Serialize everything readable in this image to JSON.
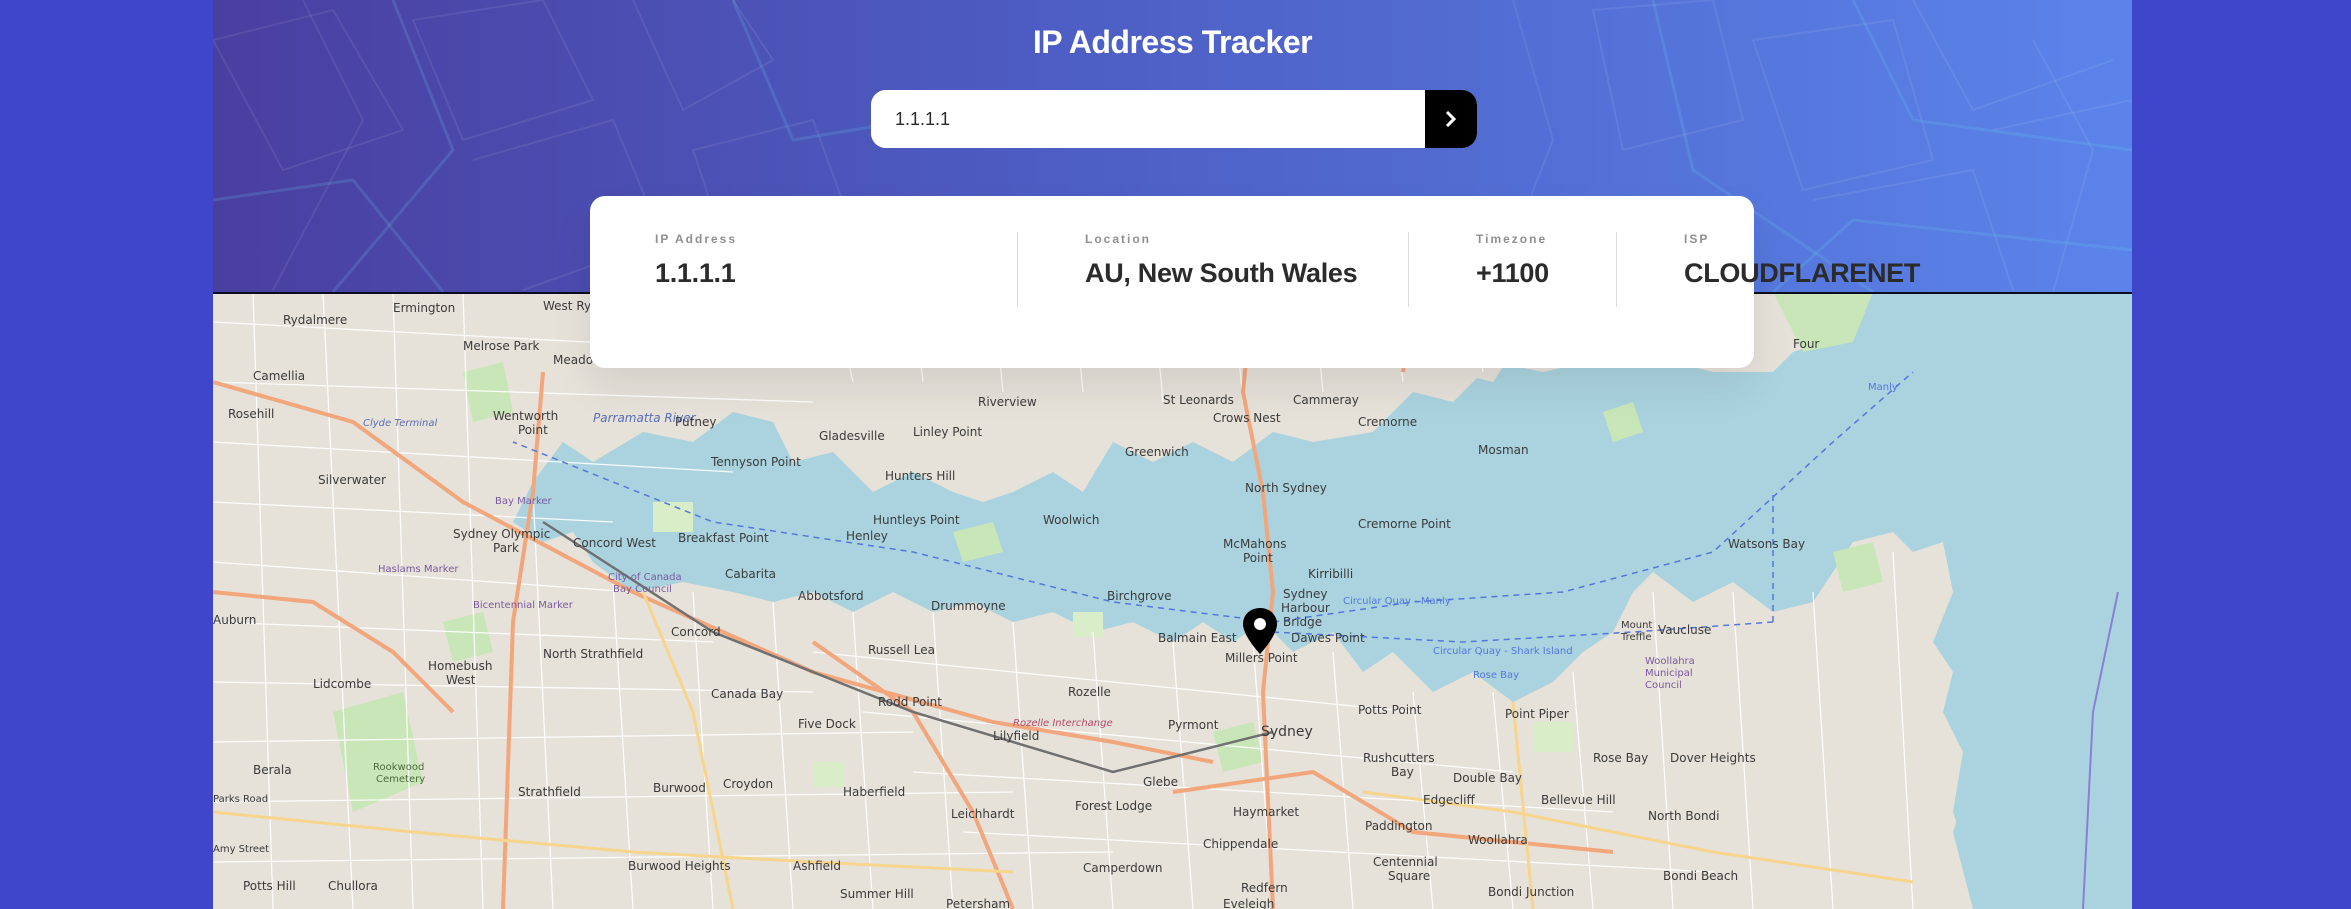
{
  "header": {
    "title": "IP Address Tracker"
  },
  "search": {
    "value": "1.1.1.1",
    "button_icon": "chevron-right-icon"
  },
  "info": {
    "ip": {
      "label": "IP Address",
      "value": "1.1.1.1"
    },
    "location": {
      "label": "Location",
      "value": "AU, New South Wales"
    },
    "timezone": {
      "label": "Timezone",
      "value": "+1100"
    },
    "isp": {
      "label": "ISP",
      "value": "CLOUDFLARENET"
    }
  },
  "map": {
    "marker_icon": "location-pin-icon",
    "place_labels": [
      "Ermington",
      "Rydalmere",
      "West Ryde",
      "Melrose Park",
      "Meadow",
      "Camellia",
      "Rosehill",
      "Wentworth Point",
      "Parramatta River",
      "Clyde Terminal",
      "Silverwater",
      "Sydney Olympic Park",
      "Bay Marker",
      "Concord West",
      "Haslams Marker",
      "Bicentennial Marker",
      "Putney",
      "Gladesville",
      "Tennyson Point",
      "Riverview",
      "Linley Point",
      "St Leonards",
      "Crows Nest",
      "Cammeray",
      "Cremorne",
      "Mosman",
      "Hunters Hill",
      "Huntleys Point",
      "Greenwich",
      "Woolwich",
      "North Sydney",
      "Breakfast Point",
      "Henley",
      "Cabarita",
      "City of Canada Bay Council",
      "Abbotsford",
      "Drummoyne",
      "Birchgrove",
      "McMahons Point",
      "Kirribilli",
      "Cremorne Point",
      "Sydney Harbour Bridge",
      "Balmain East",
      "Millers Point",
      "Dawes Point",
      "Concord",
      "Russell Lea",
      "Rozelle",
      "North Strathfield",
      "Homebush West",
      "Lidcombe",
      "Canada Bay",
      "Rodd Point",
      "Five Dock",
      "Lilyfield",
      "Pyrmont",
      "Sydney",
      "Potts Point",
      "Rushcutters Bay",
      "Double Bay",
      "Point Piper",
      "Rose Bay",
      "Vaucluse",
      "Watsons Bay",
      "Dover Heights",
      "Woollahra Municipal Council",
      "Mount Treffle",
      "Rookwood Cemetery",
      "Berala",
      "Strathfield",
      "Burwood",
      "Croydon",
      "Haberfield",
      "Leichhardt",
      "Glebe",
      "Forest Lodge",
      "Haymarket",
      "Paddington",
      "Edgecliff",
      "Bellevue Hill",
      "North Bondi",
      "Bondi Beach",
      "Chippendale",
      "Woollahra",
      "Centennial Square",
      "Bondi Junction",
      "Camperdown",
      "Redfern",
      "Ashfield",
      "Burwood Heights",
      "Summer Hill",
      "Petersham",
      "Eveleigh",
      "Potts Hill",
      "Chullora",
      "Auburn",
      "Rozelle Interchange",
      "Circular Quay - Manly",
      "Circular Quay - Shark Island",
      "Rose Bay",
      "Manly",
      "Four",
      "Parks Road",
      "Amy Street"
    ]
  }
}
